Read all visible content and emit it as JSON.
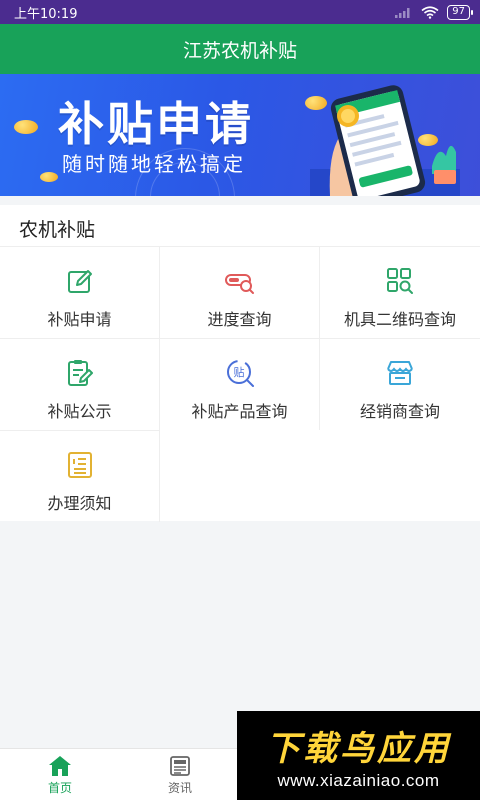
{
  "status_bar": {
    "time": "上午10:19",
    "battery": "97"
  },
  "header": {
    "title": "江苏农机补贴"
  },
  "banner": {
    "title": "补贴申请",
    "subtitle": "随时随地轻松搞定"
  },
  "section": {
    "title": "农机补贴",
    "items": [
      {
        "label": "补贴申请",
        "icon": "edit-icon",
        "color": "#2fa66a"
      },
      {
        "label": "进度查询",
        "icon": "progress-search-icon",
        "color": "#e05a5a"
      },
      {
        "label": "机具二维码查询",
        "icon": "qr-search-icon",
        "color": "#2fa66a"
      },
      {
        "label": "补贴公示",
        "icon": "clipboard-edit-icon",
        "color": "#2fa66a"
      },
      {
        "label": "补贴产品查询",
        "icon": "tag-search-icon",
        "color": "#4a6fd8"
      },
      {
        "label": "经销商查询",
        "icon": "store-icon",
        "color": "#3aa6d8"
      },
      {
        "label": "办理须知",
        "icon": "notice-list-icon",
        "color": "#e2b233"
      }
    ]
  },
  "tabs": [
    {
      "label": "首页",
      "icon": "home-icon",
      "active": true
    },
    {
      "label": "资讯",
      "icon": "news-icon",
      "active": false
    }
  ],
  "watermark": {
    "main": "下载鸟应用",
    "url": "www.xiazainiao.com"
  },
  "colors": {
    "brand": "#18a259",
    "status_bar": "#4b2c8f",
    "banner": "#2c6cf2",
    "tab_active": "#18a259",
    "tab_inactive": "#666666"
  }
}
